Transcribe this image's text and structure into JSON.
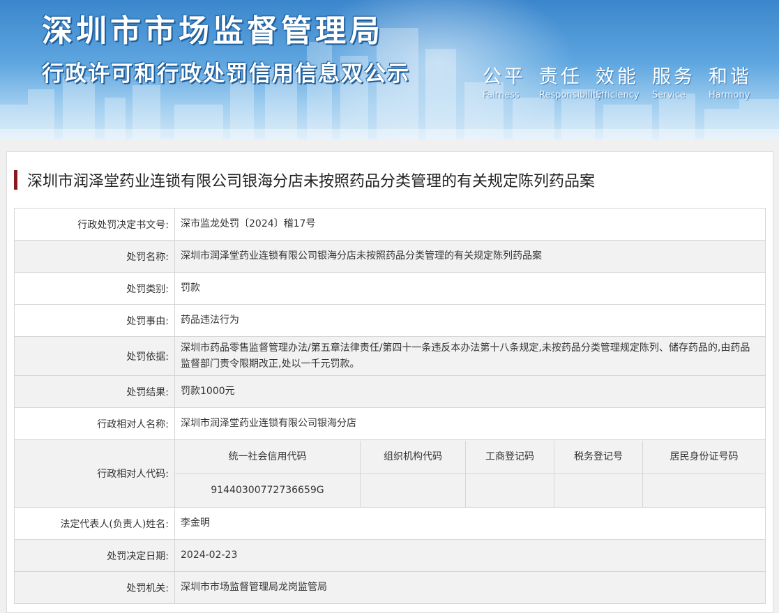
{
  "header": {
    "title": "深圳市市场监督管理局",
    "subtitle": "行政许可和行政处罚信用信息双公示",
    "values": [
      {
        "cn": "公平",
        "en": "Fairness"
      },
      {
        "cn": "责任",
        "en": "Responsibility"
      },
      {
        "cn": "效能",
        "en": "Efficiency"
      },
      {
        "cn": "服务",
        "en": "Service"
      },
      {
        "cn": "和谐",
        "en": "Harmony"
      }
    ]
  },
  "case": {
    "title": "深圳市润泽堂药业连锁有限公司银海分店未按照药品分类管理的有关规定陈列药品案",
    "rows": [
      {
        "label": "行政处罚决定书文号:",
        "value": "深市监龙处罚〔2024〕稽17号"
      },
      {
        "label": "处罚名称:",
        "value": "深圳市润泽堂药业连锁有限公司银海分店未按照药品分类管理的有关规定陈列药品案"
      },
      {
        "label": "处罚类别:",
        "value": "罚款"
      },
      {
        "label": "处罚事由:",
        "value": "药品违法行为"
      },
      {
        "label": "处罚依据:",
        "value": "深圳市药品零售监督管理办法/第五章法律责任/第四十一条违反本办法第十八条规定,未按药品分类管理规定陈列、储存药品的,由药品监督部门责令限期改正,处以一千元罚款。"
      },
      {
        "label": "处罚结果:",
        "value": "罚款1000元"
      },
      {
        "label": "行政相对人名称:",
        "value": "深圳市润泽堂药业连锁有限公司银海分店"
      }
    ],
    "codes": {
      "label": "行政相对人代码:",
      "headers": [
        "统一社会信用代码",
        "组织机构代码",
        "工商登记码",
        "税务登记号",
        "居民身份证号码"
      ],
      "values": [
        "91440300772736659G",
        "",
        "",
        "",
        ""
      ]
    },
    "rows2": [
      {
        "label": "法定代表人(负责人)姓名:",
        "value": "李金明"
      },
      {
        "label": "处罚决定日期:",
        "value": "2024-02-23"
      },
      {
        "label": "处罚机关:",
        "value": "深圳市市场监督管理局龙岗监管局"
      }
    ]
  }
}
